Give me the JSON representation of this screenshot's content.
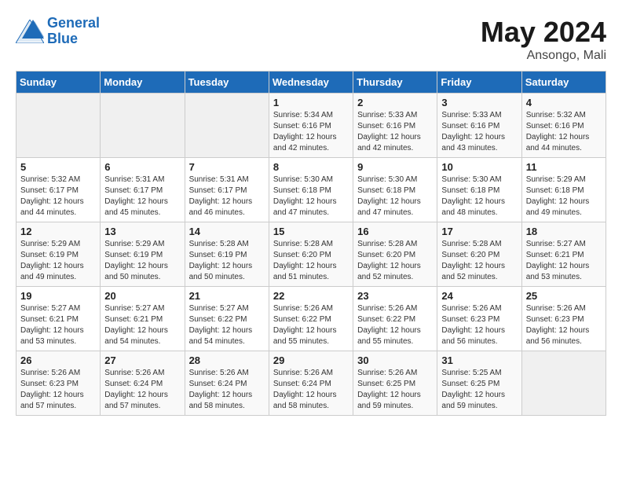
{
  "logo": {
    "line1": "General",
    "line2": "Blue"
  },
  "title": "May 2024",
  "location": "Ansongo, Mali",
  "days_header": [
    "Sunday",
    "Monday",
    "Tuesday",
    "Wednesday",
    "Thursday",
    "Friday",
    "Saturday"
  ],
  "weeks": [
    [
      {
        "day": "",
        "sunrise": "",
        "sunset": "",
        "daylight": ""
      },
      {
        "day": "",
        "sunrise": "",
        "sunset": "",
        "daylight": ""
      },
      {
        "day": "",
        "sunrise": "",
        "sunset": "",
        "daylight": ""
      },
      {
        "day": "1",
        "sunrise": "Sunrise: 5:34 AM",
        "sunset": "Sunset: 6:16 PM",
        "daylight": "Daylight: 12 hours and 42 minutes."
      },
      {
        "day": "2",
        "sunrise": "Sunrise: 5:33 AM",
        "sunset": "Sunset: 6:16 PM",
        "daylight": "Daylight: 12 hours and 42 minutes."
      },
      {
        "day": "3",
        "sunrise": "Sunrise: 5:33 AM",
        "sunset": "Sunset: 6:16 PM",
        "daylight": "Daylight: 12 hours and 43 minutes."
      },
      {
        "day": "4",
        "sunrise": "Sunrise: 5:32 AM",
        "sunset": "Sunset: 6:16 PM",
        "daylight": "Daylight: 12 hours and 44 minutes."
      }
    ],
    [
      {
        "day": "5",
        "sunrise": "Sunrise: 5:32 AM",
        "sunset": "Sunset: 6:17 PM",
        "daylight": "Daylight: 12 hours and 44 minutes."
      },
      {
        "day": "6",
        "sunrise": "Sunrise: 5:31 AM",
        "sunset": "Sunset: 6:17 PM",
        "daylight": "Daylight: 12 hours and 45 minutes."
      },
      {
        "day": "7",
        "sunrise": "Sunrise: 5:31 AM",
        "sunset": "Sunset: 6:17 PM",
        "daylight": "Daylight: 12 hours and 46 minutes."
      },
      {
        "day": "8",
        "sunrise": "Sunrise: 5:30 AM",
        "sunset": "Sunset: 6:18 PM",
        "daylight": "Daylight: 12 hours and 47 minutes."
      },
      {
        "day": "9",
        "sunrise": "Sunrise: 5:30 AM",
        "sunset": "Sunset: 6:18 PM",
        "daylight": "Daylight: 12 hours and 47 minutes."
      },
      {
        "day": "10",
        "sunrise": "Sunrise: 5:30 AM",
        "sunset": "Sunset: 6:18 PM",
        "daylight": "Daylight: 12 hours and 48 minutes."
      },
      {
        "day": "11",
        "sunrise": "Sunrise: 5:29 AM",
        "sunset": "Sunset: 6:18 PM",
        "daylight": "Daylight: 12 hours and 49 minutes."
      }
    ],
    [
      {
        "day": "12",
        "sunrise": "Sunrise: 5:29 AM",
        "sunset": "Sunset: 6:19 PM",
        "daylight": "Daylight: 12 hours and 49 minutes."
      },
      {
        "day": "13",
        "sunrise": "Sunrise: 5:29 AM",
        "sunset": "Sunset: 6:19 PM",
        "daylight": "Daylight: 12 hours and 50 minutes."
      },
      {
        "day": "14",
        "sunrise": "Sunrise: 5:28 AM",
        "sunset": "Sunset: 6:19 PM",
        "daylight": "Daylight: 12 hours and 50 minutes."
      },
      {
        "day": "15",
        "sunrise": "Sunrise: 5:28 AM",
        "sunset": "Sunset: 6:20 PM",
        "daylight": "Daylight: 12 hours and 51 minutes."
      },
      {
        "day": "16",
        "sunrise": "Sunrise: 5:28 AM",
        "sunset": "Sunset: 6:20 PM",
        "daylight": "Daylight: 12 hours and 52 minutes."
      },
      {
        "day": "17",
        "sunrise": "Sunrise: 5:28 AM",
        "sunset": "Sunset: 6:20 PM",
        "daylight": "Daylight: 12 hours and 52 minutes."
      },
      {
        "day": "18",
        "sunrise": "Sunrise: 5:27 AM",
        "sunset": "Sunset: 6:21 PM",
        "daylight": "Daylight: 12 hours and 53 minutes."
      }
    ],
    [
      {
        "day": "19",
        "sunrise": "Sunrise: 5:27 AM",
        "sunset": "Sunset: 6:21 PM",
        "daylight": "Daylight: 12 hours and 53 minutes."
      },
      {
        "day": "20",
        "sunrise": "Sunrise: 5:27 AM",
        "sunset": "Sunset: 6:21 PM",
        "daylight": "Daylight: 12 hours and 54 minutes."
      },
      {
        "day": "21",
        "sunrise": "Sunrise: 5:27 AM",
        "sunset": "Sunset: 6:22 PM",
        "daylight": "Daylight: 12 hours and 54 minutes."
      },
      {
        "day": "22",
        "sunrise": "Sunrise: 5:26 AM",
        "sunset": "Sunset: 6:22 PM",
        "daylight": "Daylight: 12 hours and 55 minutes."
      },
      {
        "day": "23",
        "sunrise": "Sunrise: 5:26 AM",
        "sunset": "Sunset: 6:22 PM",
        "daylight": "Daylight: 12 hours and 55 minutes."
      },
      {
        "day": "24",
        "sunrise": "Sunrise: 5:26 AM",
        "sunset": "Sunset: 6:23 PM",
        "daylight": "Daylight: 12 hours and 56 minutes."
      },
      {
        "day": "25",
        "sunrise": "Sunrise: 5:26 AM",
        "sunset": "Sunset: 6:23 PM",
        "daylight": "Daylight: 12 hours and 56 minutes."
      }
    ],
    [
      {
        "day": "26",
        "sunrise": "Sunrise: 5:26 AM",
        "sunset": "Sunset: 6:23 PM",
        "daylight": "Daylight: 12 hours and 57 minutes."
      },
      {
        "day": "27",
        "sunrise": "Sunrise: 5:26 AM",
        "sunset": "Sunset: 6:24 PM",
        "daylight": "Daylight: 12 hours and 57 minutes."
      },
      {
        "day": "28",
        "sunrise": "Sunrise: 5:26 AM",
        "sunset": "Sunset: 6:24 PM",
        "daylight": "Daylight: 12 hours and 58 minutes."
      },
      {
        "day": "29",
        "sunrise": "Sunrise: 5:26 AM",
        "sunset": "Sunset: 6:24 PM",
        "daylight": "Daylight: 12 hours and 58 minutes."
      },
      {
        "day": "30",
        "sunrise": "Sunrise: 5:26 AM",
        "sunset": "Sunset: 6:25 PM",
        "daylight": "Daylight: 12 hours and 59 minutes."
      },
      {
        "day": "31",
        "sunrise": "Sunrise: 5:25 AM",
        "sunset": "Sunset: 6:25 PM",
        "daylight": "Daylight: 12 hours and 59 minutes."
      },
      {
        "day": "",
        "sunrise": "",
        "sunset": "",
        "daylight": ""
      }
    ]
  ]
}
